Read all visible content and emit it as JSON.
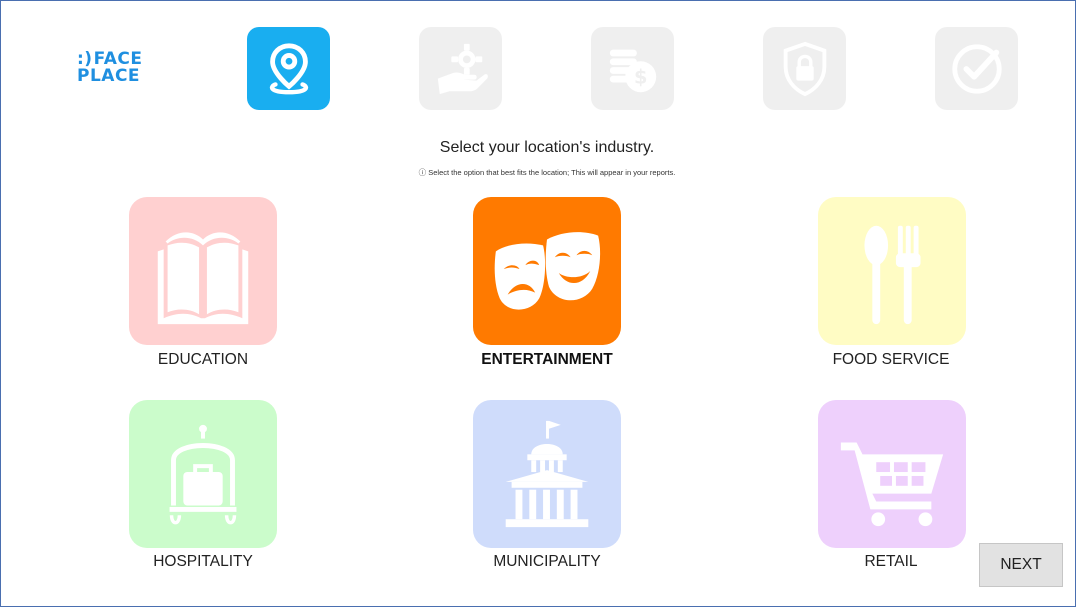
{
  "logo": {
    "line1_mark": ":)",
    "line1_text": "FACE",
    "line2_text": "PLACE"
  },
  "steps": [
    {
      "icon": "location-pin-icon",
      "state": "active"
    },
    {
      "icon": "gear-hand-icon",
      "state": "inactive"
    },
    {
      "icon": "coins-dollar-icon",
      "state": "inactive"
    },
    {
      "icon": "shield-lock-icon",
      "state": "inactive"
    },
    {
      "icon": "check-circle-icon",
      "state": "inactive"
    }
  ],
  "page": {
    "heading": "Select your location's industry.",
    "subheading": "ⓘ Select the option that best fits the location; This will appear in your reports."
  },
  "industries": [
    {
      "label": "EDUCATION",
      "icon": "open-book-icon",
      "color": "#ffd0d0",
      "selected": false
    },
    {
      "label": "ENTERTAINMENT",
      "icon": "theater-masks-icon",
      "color": "#ff7a00",
      "selected": true
    },
    {
      "label": "FOOD SERVICE",
      "icon": "spoon-fork-icon",
      "color": "#fffcc4",
      "selected": false
    },
    {
      "label": "HOSPITALITY",
      "icon": "luggage-cart-icon",
      "color": "#cbfccb",
      "selected": false
    },
    {
      "label": "MUNICIPALITY",
      "icon": "capitol-building-icon",
      "color": "#cfdcfb",
      "selected": false
    },
    {
      "label": "RETAIL",
      "icon": "shopping-cart-icon",
      "color": "#eed0fc",
      "selected": false
    }
  ],
  "next_label": "NEXT"
}
